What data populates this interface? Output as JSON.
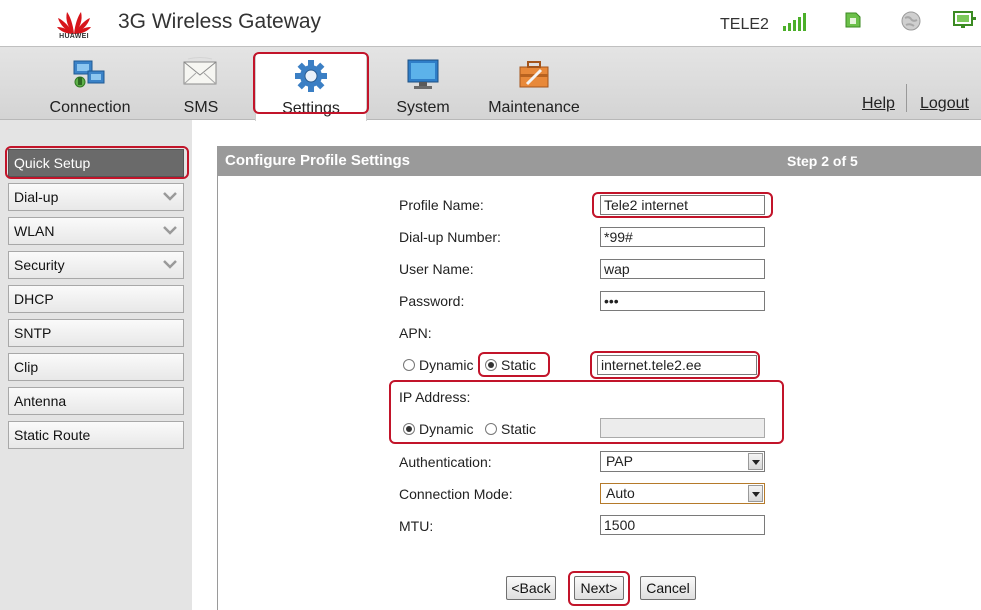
{
  "header": {
    "brand": "HUAWEI",
    "title": "3G Wireless Gateway",
    "carrier": "TELE2",
    "icons": [
      "signal-icon",
      "sim-card-icon",
      "globe-icon",
      "connection-monitor-icon"
    ]
  },
  "nav": {
    "items": [
      {
        "label": "Connection",
        "icon": "connection-icon"
      },
      {
        "label": "SMS",
        "icon": "sms-envelope-icon"
      },
      {
        "label": "Settings",
        "icon": "gear-icon"
      },
      {
        "label": "System",
        "icon": "monitor-icon"
      },
      {
        "label": "Maintenance",
        "icon": "toolbox-icon"
      }
    ],
    "active": "Settings",
    "help": "Help",
    "logout": "Logout"
  },
  "sidebar": {
    "items": [
      {
        "label": "Quick Setup",
        "expandable": false
      },
      {
        "label": "Dial-up",
        "expandable": true
      },
      {
        "label": "WLAN",
        "expandable": true
      },
      {
        "label": "Security",
        "expandable": true
      },
      {
        "label": "DHCP",
        "expandable": false
      },
      {
        "label": "SNTP",
        "expandable": false
      },
      {
        "label": "Clip",
        "expandable": false
      },
      {
        "label": "Antenna",
        "expandable": false
      },
      {
        "label": "Static Route",
        "expandable": false
      }
    ],
    "active": "Quick Setup"
  },
  "panel": {
    "title": "Configure Profile Settings",
    "step": "Step 2 of 5"
  },
  "form": {
    "profile_name": {
      "label": "Profile Name:",
      "value": "Tele2 internet"
    },
    "dialup_number": {
      "label": "Dial-up Number:",
      "value": "*99#"
    },
    "user_name": {
      "label": "User Name:",
      "value": "wap"
    },
    "password": {
      "label": "Password:",
      "value": "•••"
    },
    "apn": {
      "label": "APN:",
      "dynamic": "Dynamic",
      "static": "Static",
      "selected": "Static",
      "value": "internet.tele2.ee"
    },
    "ip_address": {
      "label": "IP Address:",
      "dynamic": "Dynamic",
      "static": "Static",
      "selected": "Dynamic",
      "value": ""
    },
    "authentication": {
      "label": "Authentication:",
      "value": "PAP"
    },
    "connection_mode": {
      "label": "Connection Mode:",
      "value": "Auto"
    },
    "mtu": {
      "label": "MTU:",
      "value": "1500"
    }
  },
  "buttons": {
    "back": "<Back",
    "next": "Next>",
    "cancel": "Cancel"
  },
  "colors": {
    "highlight": "#c2142a",
    "panel_header": "#9a9a9a",
    "active_side": "#6a6a6a"
  }
}
